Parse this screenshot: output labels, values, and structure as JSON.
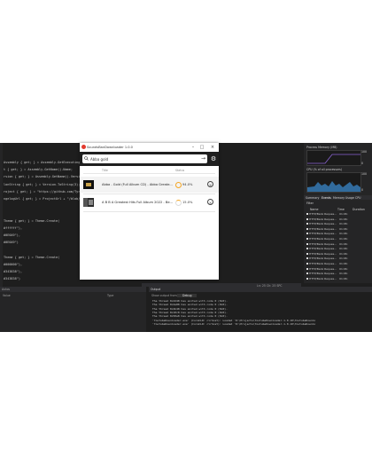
{
  "dialog": {
    "title": "SoundsBanDownloader 1.0.0",
    "search_value": "Abba gold",
    "columns": {
      "title": "Title",
      "status": "Status"
    },
    "items": [
      {
        "title": "Abba - Gold (Full Album CD) - Abba Greate...",
        "progress": "94.0%"
      },
      {
        "title": "A B B A Greatest Hits Full Album 2022 - Be...",
        "progress": "15.0%"
      }
    ]
  },
  "ide": {
    "code_lines": [
      "Assembly { get; } = Assembly.GetExecutingAssembly();",
      "t { get; } = Assembly.GetName().Name;",
      "rsion { get; } = Assembly.GetName().Version;",
      "lonString { get; } = Version.ToString(3);",
      "roject { get; } = \"https://github.com/Tyrrrz/\";",
      "ngelogUrl { get; } = ProjectUrl + \"/blob/master/Ch",
      "",
      "",
      "Theme { get; } = Theme.Create(",
      "  #ffffff\"),",
      "  #0E6A9\"),",
      "  #0E6A9\")",
      "",
      "Theme { get; } = Theme.Create(",
      "  #000000\"),",
      "  #343838\"),",
      "  #343838\")"
    ],
    "statusbar": "Ln: 25   Ch: 25   SPC",
    "bottom_left_header": "Autos",
    "bottom_left_cols": [
      "Value",
      "Type"
    ],
    "output_header": "Output",
    "output_source_label": "Show output from:",
    "output_source_value": "Debug",
    "output_lines": [
      "The thread 0x4248 has exited with code 0 (0x0).",
      "The thread 0x2a88 has exited with code 0 (0x0).",
      "The thread 0x2b48 has exited with code 0 (0x0).",
      "The thread 0x10c8 has exited with code 0 (0x0).",
      "The thread 0x50e8 has exited with code 0 (0x0).",
      "'YoutubeDownloader.exe' (CoreCLR: clrhost): Loaded 'D:\\Projects\\YoutubeDownloader-1.0.10\\YoutubeDownlo",
      "'YoutubeDownloader.exe' (CoreCLR: clrhost): Loaded 'D:\\Projects\\YoutubeDownloader-1.0.10\\YoutubeDownlo"
    ]
  },
  "diagnostics": {
    "memory_title": "Process Memory (MB)",
    "memory_max": "100",
    "memory_min": "0",
    "cpu_title": "CPU (% of all processors)",
    "cpu_max": "100",
    "cpu_min": "0",
    "tabs": [
      "Summary",
      "Events",
      "Memory Usage",
      "CPU"
    ],
    "filter_label": "Filter",
    "cols": [
      "Name",
      "Time",
      "Duration"
    ],
    "events": [
      {
        "name": "HTTP/Bank Reques...",
        "time": "01:06:"
      },
      {
        "name": "HTTP/Bank Reques...",
        "time": "01:06:"
      },
      {
        "name": "HTTP/Bank Reques...",
        "time": "01:06:"
      },
      {
        "name": "HTTP/Bank Reques...",
        "time": "01:06:"
      },
      {
        "name": "HTTP/Bank Reques...",
        "time": "01:06:"
      },
      {
        "name": "HTTP/Bank Reques...",
        "time": "01:06:"
      },
      {
        "name": "HTTP/Bank Reques...",
        "time": "01:06:"
      },
      {
        "name": "HTTP/Bank Reques...",
        "time": "01:06:"
      },
      {
        "name": "HTTP/Bank Reques...",
        "time": "01:06:"
      },
      {
        "name": "HTTP/Bank Reques...",
        "time": "01:06:"
      },
      {
        "name": "HTTP/Bank Reques...",
        "time": "01:06:"
      },
      {
        "name": "HTTP/Bank Reques...",
        "time": "01:06:"
      },
      {
        "name": "HTTP/Bank Reques...",
        "time": "01:06:"
      },
      {
        "name": "HTTP/Bank Reques...",
        "time": "01:06:"
      }
    ]
  },
  "colors": {
    "accent": "#0e639c",
    "progress_orange": "#f5a623",
    "app_red": "#e23a2e"
  }
}
